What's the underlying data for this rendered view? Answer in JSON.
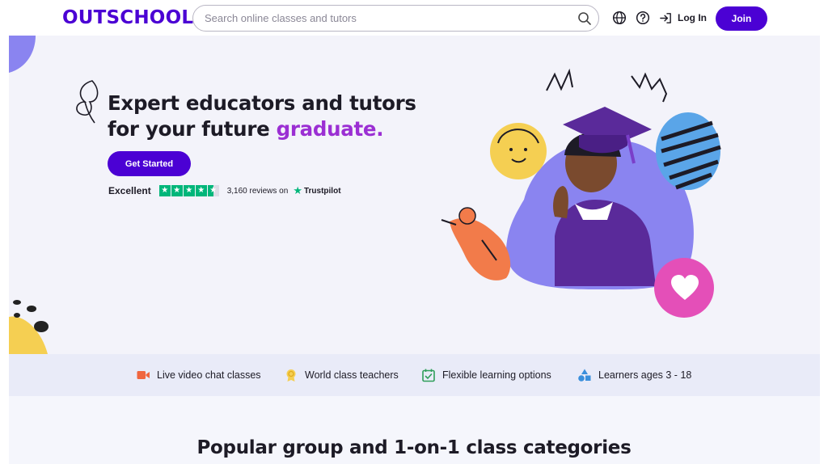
{
  "header": {
    "logo": "OUTSCHOOL",
    "search_placeholder": "Search online classes and tutors",
    "login_label": "Log In",
    "join_label": "Join"
  },
  "hero": {
    "title_line1": "Expert educators and tutors",
    "title_line2_prefix": "for your future ",
    "title_line2_accent": "graduate.",
    "cta_label": "Get Started",
    "rating_label": "Excellent",
    "stars": 4.5,
    "reviews_text": "3,160 reviews on",
    "trustpilot_label": "Trustpilot"
  },
  "features": [
    {
      "label": "Live video chat classes",
      "icon": "video-camera-icon"
    },
    {
      "label": "World class teachers",
      "icon": "award-medal-icon"
    },
    {
      "label": "Flexible learning options",
      "icon": "calendar-check-icon"
    },
    {
      "label": "Learners ages 3 - 18",
      "icon": "shapes-icon"
    }
  ],
  "section": {
    "title": "Popular group and 1-on-1 class categories"
  },
  "colors": {
    "brand": "#4b01d4",
    "accent": "#9b2fd3",
    "hero_bg": "#f3f3fa",
    "trustpilot": "#00b67a",
    "heart": "#e44fb8"
  }
}
